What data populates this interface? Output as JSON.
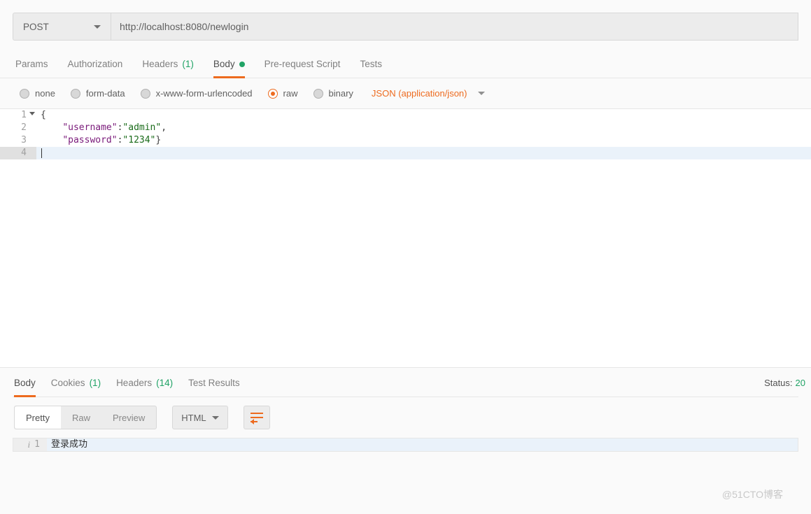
{
  "request": {
    "method": "POST",
    "url": "http://localhost:8080/newlogin"
  },
  "request_tabs": {
    "params": "Params",
    "authorization": "Authorization",
    "headers": {
      "label": "Headers",
      "count": "(1)"
    },
    "body": "Body",
    "pre_request": "Pre-request Script",
    "tests": "Tests"
  },
  "body_types": {
    "none": "none",
    "form_data": "form-data",
    "urlencoded": "x-www-form-urlencoded",
    "raw": "raw",
    "binary": "binary",
    "content_type": "JSON (application/json)"
  },
  "editor_lines": [
    {
      "n": "1",
      "text": "{"
    },
    {
      "n": "2",
      "key": "\"username\"",
      "colon": ":",
      "val": "\"admin\"",
      "tail": ","
    },
    {
      "n": "3",
      "key": "\"password\"",
      "colon": ":",
      "val": "\"1234\"",
      "tail": "}"
    },
    {
      "n": "4",
      "text": ""
    }
  ],
  "response_tabs": {
    "body": "Body",
    "cookies": {
      "label": "Cookies",
      "count": "(1)"
    },
    "headers": {
      "label": "Headers",
      "count": "(14)"
    },
    "test_results": "Test Results"
  },
  "response_status": {
    "label": "Status:",
    "value": "20"
  },
  "response_toolbar": {
    "pretty": "Pretty",
    "raw": "Raw",
    "preview": "Preview",
    "format": "HTML"
  },
  "response_body": {
    "line1_num": "1",
    "line1_text": "登录成功"
  },
  "watermark": "@51CTO博客"
}
